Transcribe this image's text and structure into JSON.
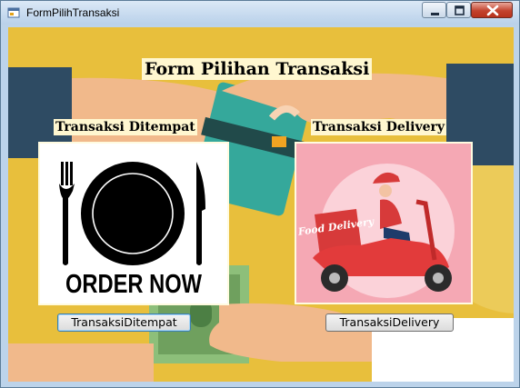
{
  "window": {
    "title": "FormPilihTransaksi",
    "icon": "form-app-icon"
  },
  "controls": {
    "minimize_icon": "minimize-icon",
    "maximize_icon": "maximize-icon",
    "close_icon": "close-icon"
  },
  "form": {
    "heading": "Form Pilihan Transaksi",
    "dine_in": {
      "label": "Transaksi Ditempat",
      "image_text": "ORDER NOW",
      "button": "TransaksiDitempat"
    },
    "delivery": {
      "label": "Transaksi Delivery",
      "image_text": "Food Delivery",
      "button": "TransaksiDelivery"
    }
  },
  "colors": {
    "background": "#e8bf3c",
    "label_bg": "#fff7d0",
    "delivery_bg": "#f5a8b4"
  }
}
